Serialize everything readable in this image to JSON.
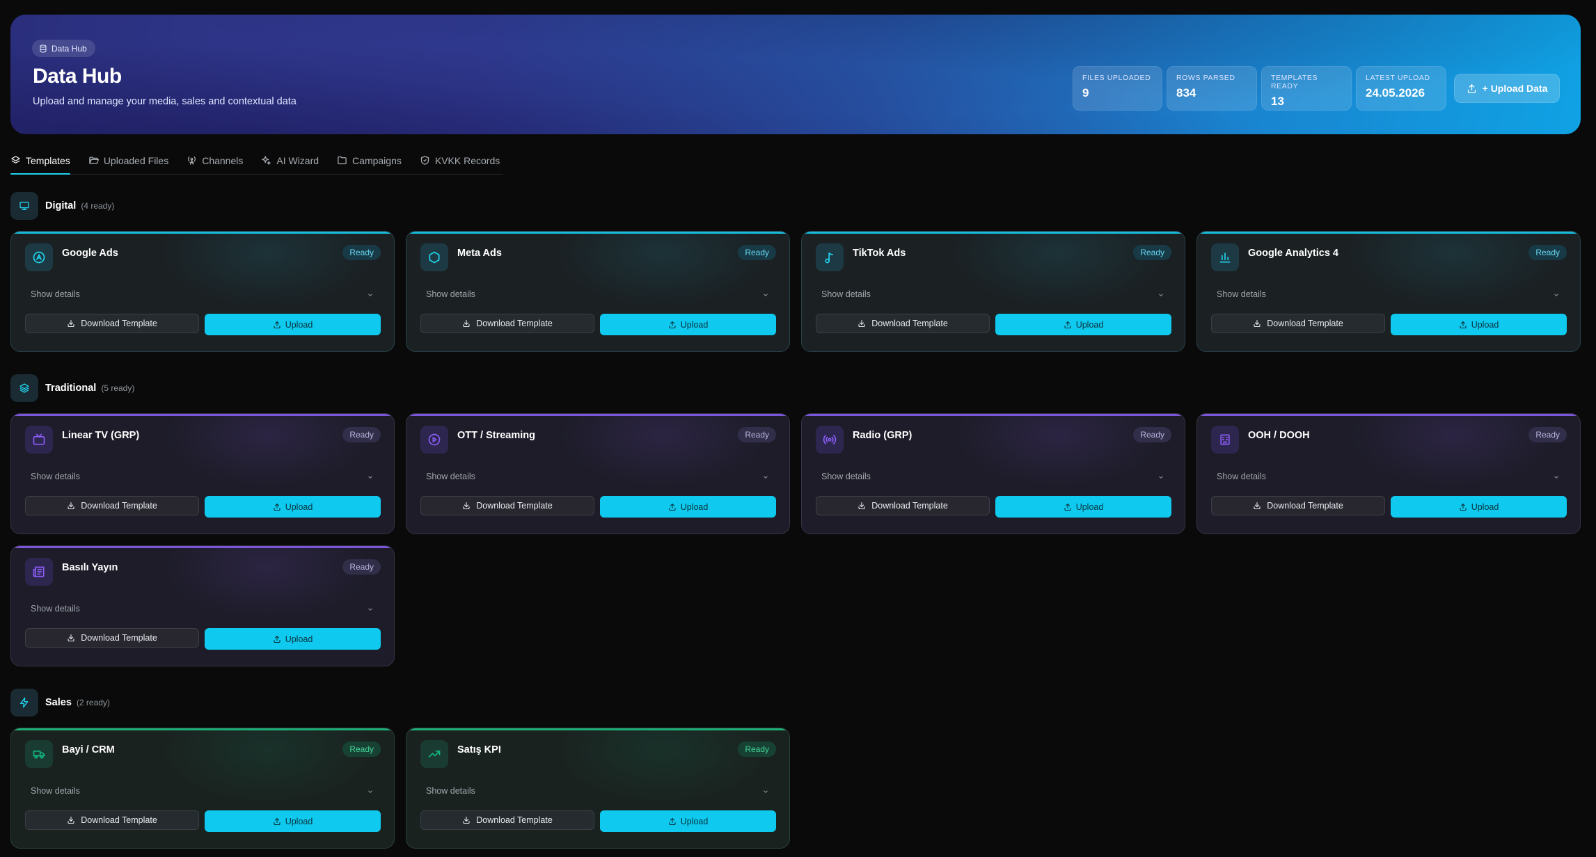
{
  "hero": {
    "pill_label": "Data Hub",
    "title": "Data Hub",
    "subtitle": "Upload and manage your media, sales and contextual data",
    "stats": [
      {
        "label": "FILES UPLOADED",
        "value": "9"
      },
      {
        "label": "ROWS PARSED",
        "value": "834"
      },
      {
        "label": "TEMPLATES READY",
        "value": "13"
      },
      {
        "label": "LATEST UPLOAD",
        "value": "24.05.2026"
      }
    ],
    "upload_button": "+ Upload Data"
  },
  "tabs": [
    {
      "label": "Templates",
      "icon": "layers-icon",
      "active": true
    },
    {
      "label": "Uploaded Files",
      "icon": "folder-open-icon"
    },
    {
      "label": "Channels",
      "icon": "radio-tower-icon"
    },
    {
      "label": "AI Wizard",
      "icon": "sparkles-icon"
    },
    {
      "label": "Campaigns",
      "icon": "folder-icon"
    },
    {
      "label": "KVKK Records",
      "icon": "shield-icon"
    }
  ],
  "sections": {
    "digital": {
      "title": "Digital",
      "count": "(4 ready)",
      "icon": "monitor-icon"
    },
    "traditional": {
      "title": "Traditional",
      "count": "(5 ready)",
      "icon": "layers-icon"
    },
    "sales": {
      "title": "Sales",
      "count": "(2 ready)",
      "icon": "zap-icon"
    }
  },
  "colors": {
    "accent": "#0fc9ee",
    "digital": "#19b9da",
    "traditional": "#7c55d8",
    "sales": "#1fae79"
  },
  "card_labels": {
    "badge": "Ready",
    "details": "Show details",
    "download": "Download Template",
    "upload": "Upload"
  },
  "cards": [
    {
      "name": "Google Ads",
      "icon": "google-ads-icon"
    },
    {
      "name": "Meta Ads",
      "icon": "hexagon-icon"
    },
    {
      "name": "TikTok Ads",
      "icon": "music-note-icon"
    },
    {
      "name": "Google Analytics 4",
      "icon": "bar-chart-icon"
    },
    {
      "name": "Linear TV (GRP)",
      "icon": "tv-icon"
    },
    {
      "name": "OTT / Streaming",
      "icon": "play-circle-icon"
    },
    {
      "name": "Radio (GRP)",
      "icon": "radio-icon"
    },
    {
      "name": "OOH / DOOH",
      "icon": "billboard-icon"
    },
    {
      "name": "Basılı Yayın",
      "icon": "newspaper-icon"
    },
    {
      "name": "Bayi / CRM",
      "icon": "truck-icon"
    },
    {
      "name": "Satış KPI",
      "icon": "trending-up-icon"
    }
  ]
}
